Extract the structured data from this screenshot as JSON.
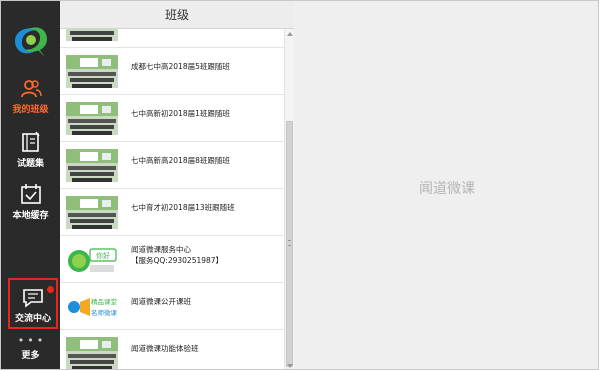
{
  "sidebar": {
    "logo": "wendao-logo-icon",
    "items": [
      {
        "label": "我的班级",
        "icon": "people-icon",
        "active": true
      },
      {
        "label": "试题集",
        "icon": "book-icon",
        "active": false
      },
      {
        "label": "本地缓存",
        "icon": "calendar-check-icon",
        "active": false
      },
      {
        "label": "交流中心",
        "icon": "chat-icon",
        "active": false,
        "badge": true
      },
      {
        "label": "更多",
        "icon": "more-dots-icon",
        "active": false
      }
    ]
  },
  "panel": {
    "title": "班级",
    "items": [
      {
        "text": "",
        "thumb": "classroom"
      },
      {
        "text": "成都七中高2018届5班跟随班",
        "thumb": "classroom"
      },
      {
        "text": "七中高新初2018届1班跟随班",
        "thumb": "classroom"
      },
      {
        "text": "七中高新高2018届8班跟随班",
        "thumb": "classroom"
      },
      {
        "text": "七中育才初2018届13班跟随班",
        "thumb": "classroom"
      },
      {
        "text": "闻道微课服务中心",
        "text2": "【服务QQ:2930251987】",
        "thumb": "service",
        "thumb_text": "你好"
      },
      {
        "text": "闻道微课公开课班",
        "thumb": "opencourse",
        "thumb_text": "精品课堂",
        "thumb_text2": "名师微课"
      },
      {
        "text": "闻道微课功能体验班",
        "thumb": "classroom"
      }
    ]
  },
  "content": {
    "placeholder": "闻道微课"
  },
  "colors": {
    "sidebar_bg": "#2a2a2a",
    "active": "#ff6a2a",
    "badge": "#e8261c",
    "accent_green": "#3cb54a",
    "accent_blue": "#1d8fd8"
  }
}
